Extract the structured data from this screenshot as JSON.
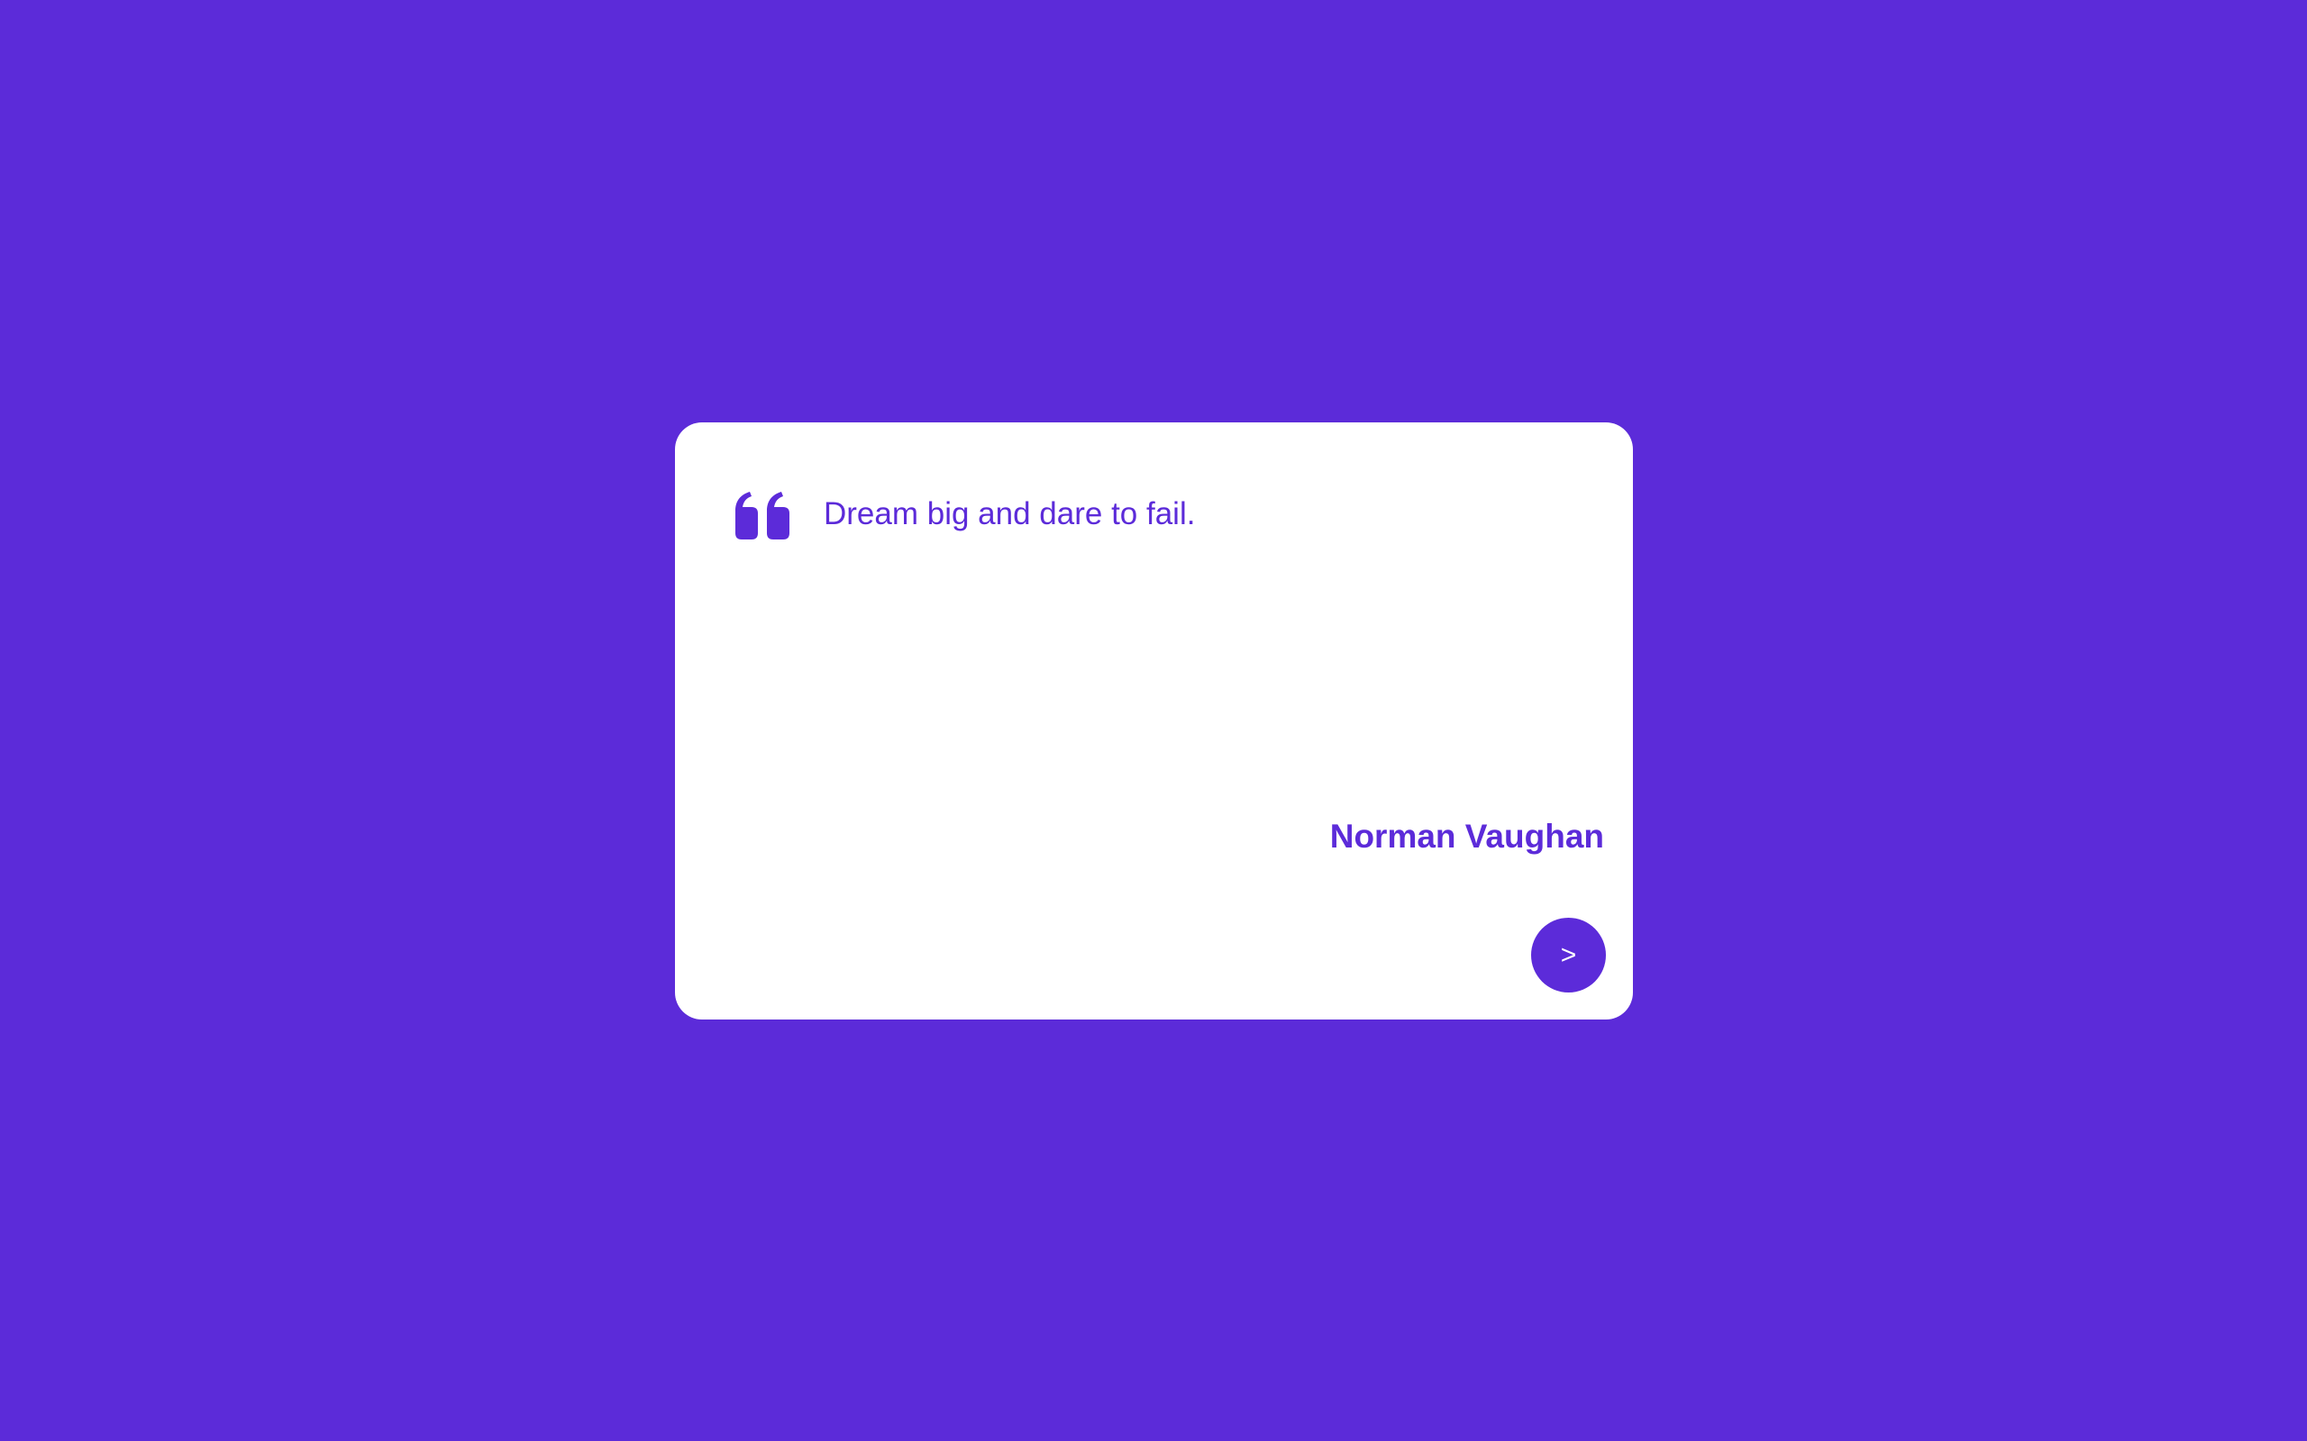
{
  "theme": {
    "background": "#5c2bd9",
    "card_background": "#ffffff",
    "accent": "#5c2bd9",
    "button_text": "#ffffff"
  },
  "quote": {
    "icon": "quote-open-icon",
    "text": "Dream big and dare to fail.",
    "author": "Norman Vaughan"
  },
  "controls": {
    "next_label": ">"
  }
}
